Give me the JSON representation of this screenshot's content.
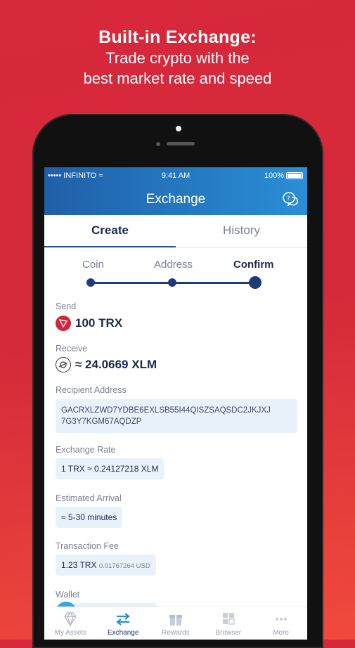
{
  "headline": {
    "title": "Built-in Exchange:",
    "line2": "Trade crypto with the",
    "line3": "best market rate and speed"
  },
  "status_bar": {
    "carrier": "••••• INFINITO",
    "time": "9:41 AM",
    "battery": "100%"
  },
  "app_bar": {
    "title": "Exchange",
    "help_icon": "help-chat-icon"
  },
  "tabs": [
    {
      "label": "Create",
      "active": true
    },
    {
      "label": "History",
      "active": false
    }
  ],
  "steps": [
    {
      "label": "Coin",
      "active": false
    },
    {
      "label": "Address",
      "active": false
    },
    {
      "label": "Confirm",
      "active": true
    }
  ],
  "send": {
    "label": "Send",
    "amount": "100 TRX",
    "icon": "tron-icon"
  },
  "receive": {
    "label": "Receive",
    "amount": "≈ 24.0669 XLM",
    "icon": "stellar-icon"
  },
  "recipient": {
    "label": "Recipient Address",
    "line1": "GACRXLZWD7YDBE6EXLSB55I44QISZSAQSDC2JKJXJ",
    "line2": "7G3Y7KGM67AQDZP"
  },
  "exchange_rate": {
    "label": "Exchange Rate",
    "value": "1 TRX ≈ 0.24127218 XLM"
  },
  "arrival": {
    "label": "Estimated Arrival",
    "value": "≈ 5-30 minutes"
  },
  "fee": {
    "label": "Transaction Fee",
    "value": "1.23 TRX",
    "usd": "0.01767264 USD"
  },
  "wallet": {
    "label": "Wallet"
  },
  "bottom_nav": [
    {
      "label": "My Assets",
      "icon": "diamond-icon",
      "active": false
    },
    {
      "label": "Exchange",
      "icon": "swap-arrows-icon",
      "active": true
    },
    {
      "label": "Rewards",
      "icon": "gift-icon",
      "active": false
    },
    {
      "label": "Browser",
      "icon": "grid-icon",
      "active": false
    },
    {
      "label": "More",
      "icon": "more-dots-icon",
      "active": false
    }
  ],
  "colors": {
    "accent": "#1f3a7a",
    "brand_red": "#d8283b",
    "header_blue": "#2a8fd6"
  }
}
